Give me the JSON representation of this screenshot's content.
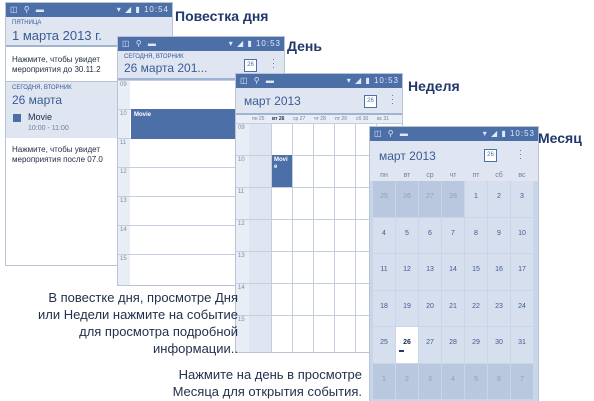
{
  "labels": {
    "agenda": "Повестка дня",
    "day": "День",
    "week": "Неделя",
    "month": "Месяц"
  },
  "agenda": {
    "time": "10:54",
    "header_small": "ПЯТНИЦА",
    "header_big": "1 марта 2013 г.",
    "hint_top_1": "Нажмите, чтобы увидет",
    "hint_top_2": "мероприятия до 30.11.2",
    "section_small": "СЕГОДНЯ, ВТОРНИК",
    "section_big": "26 марта",
    "event_title": "Movie",
    "event_time": "10:00 - 11:00",
    "hint_bot_1": "Нажмите, чтобы увидет",
    "hint_bot_2": "мероприятия после 07.0"
  },
  "day": {
    "time": "10:53",
    "header_small": "СЕГОДНЯ, ВТОРНИК",
    "header_big": "26 марта 201...",
    "cal_badge": "26",
    "hours": [
      "09",
      "10",
      "11",
      "12",
      "13",
      "14",
      "15"
    ],
    "event_title": "Movie"
  },
  "week": {
    "time": "10:53",
    "month": "март 2013",
    "cal_badge": "26",
    "days": [
      "пн 25",
      "вт 26",
      "ср 27",
      "чт 28",
      "пт 29",
      "сб 30",
      "вс 31"
    ],
    "hours": [
      "09",
      "10",
      "11",
      "12",
      "13",
      "14",
      "15"
    ],
    "event_title": "Movie"
  },
  "month": {
    "time": "10:53",
    "month": "март 2013",
    "cal_badge": "26",
    "weekdays": [
      "пн",
      "вт",
      "ср",
      "чт",
      "пт",
      "сб",
      "вс"
    ],
    "weeks": [
      [
        "25",
        "26",
        "27",
        "28",
        "1",
        "2",
        "3"
      ],
      [
        "4",
        "5",
        "6",
        "7",
        "8",
        "9",
        "10"
      ],
      [
        "11",
        "12",
        "13",
        "14",
        "15",
        "16",
        "17"
      ],
      [
        "18",
        "19",
        "20",
        "21",
        "22",
        "23",
        "24"
      ],
      [
        "25",
        "26",
        "27",
        "28",
        "29",
        "30",
        "31"
      ],
      [
        "1",
        "2",
        "3",
        "4",
        "5",
        "6",
        "7"
      ]
    ]
  },
  "captions": {
    "left": [
      "В повестке дня, просмотре Дня",
      "или Недели нажмите на событие",
      "для просмотра подробной",
      "информации.."
    ],
    "bottom": [
      "Нажмите на день в просмотре",
      "Месяца для открытия события."
    ]
  },
  "colors": {
    "statusbar": "#4d6fa8",
    "header": "#dfe6f1",
    "accent": "#3b5b95",
    "event": "#4d6fa8"
  }
}
